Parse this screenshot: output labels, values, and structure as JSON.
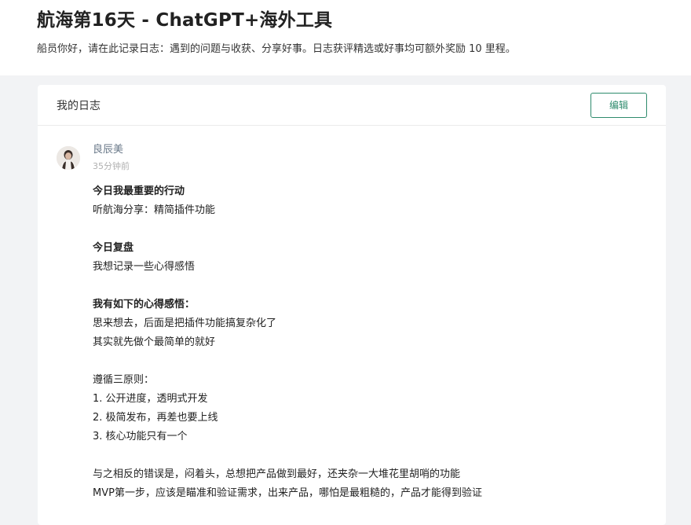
{
  "page": {
    "title": "航海第16天 - ChatGPT+海外工具",
    "subtitle": "船员你好，请在此记录日志：遇到的问题与收获、分享好事。日志获评精选或好事均可额外奖励 10 里程。"
  },
  "card": {
    "title": "我的日志",
    "edit_label": "编辑"
  },
  "entry": {
    "author": "良辰美",
    "time": "35分钟前",
    "lines": [
      "今日我最重要的行动",
      "听航海分享：精简插件功能",
      "",
      "今日复盘",
      "我想记录一些心得感悟",
      "",
      "我有如下的心得感悟：",
      "思来想去，后面是把插件功能搞复杂化了",
      "其实就先做个最简单的就好",
      "",
      "遵循三原则：",
      "1. 公开进度，透明式开发",
      "2. 极简发布，再差也要上线",
      "3. 核心功能只有一个",
      "",
      "与之相反的错误是，闷着头，总想把产品做到最好，还夹杂一大堆花里胡哨的功能",
      "MVP第一步，应该是瞄准和验证需求，出来产品，哪怕是最粗糙的，产品才能得到验证"
    ]
  }
}
